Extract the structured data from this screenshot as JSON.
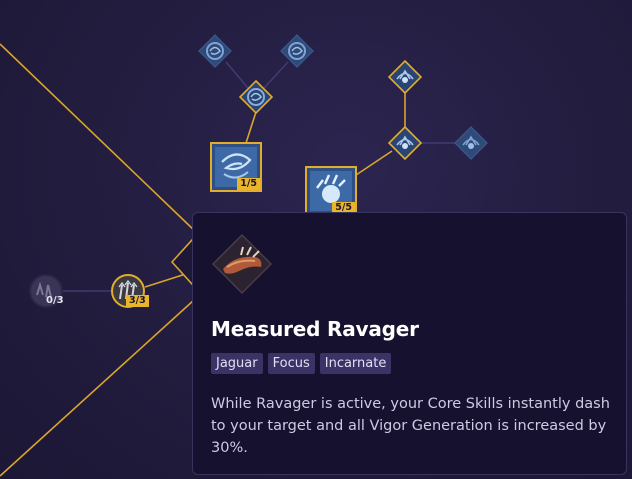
{
  "tooltip": {
    "title": "Measured Ravager",
    "tags": [
      "Jaguar",
      "Focus",
      "Incarnate"
    ],
    "description": "While Ravager is active, your Core Skills instantly dash to your target and all Vigor Generation is increased by 30%.",
    "icon": "ravager-claw-icon"
  },
  "nodes": {
    "storm_main": {
      "rank": "1/5",
      "icon": "tornado-skill-icon"
    },
    "claw_main": {
      "rank": "5/5",
      "icon": "ice-claw-skill-icon"
    },
    "left_passive_a": {
      "rank": "0/3",
      "icon": "paw-passive-icon"
    },
    "left_passive_b": {
      "rank": "3/3",
      "icon": "talon-passive-icon"
    }
  },
  "colors": {
    "line_gold": "#d9a52c",
    "line_dim": "#433a72",
    "badge": "#e9b52a",
    "tooltip_bg": "#15112e",
    "tag_bg": "#3b3366"
  }
}
